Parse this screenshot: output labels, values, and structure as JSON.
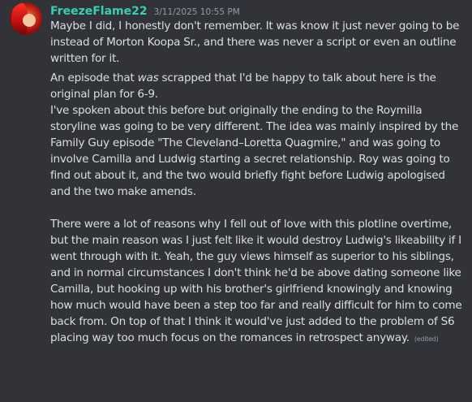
{
  "message": {
    "username": "FreezeFlame22",
    "timestamp": "3/11/2025 10:55 PM",
    "avatar_icon": "red-haired-character-avatar",
    "username_color": "#36d1b4",
    "paragraph1": "Maybe I did, I honestly don't remember. It was know it just never going to be instead of Morton Koopa Sr., and there was never a script or even an outline written for it.",
    "paragraph2_prefix": "An episode that ",
    "paragraph2_emphasis": "was",
    "paragraph2_suffix": " scrapped that I'd be happy to talk about here is the original plan for 6-9.",
    "paragraph3": "I've spoken about this before but originally the ending to the Roymilla storyline was going to be very different. The idea was mainly inspired by the Family Guy episode \"The Cleveland–Loretta Quagmire,\" and was going to involve Camilla and Ludwig starting a secret relationship. Roy was going to find out about it, and the two would briefly fight before Ludwig apologised and the two make amends.",
    "paragraph4": "There were a lot of reasons why I fell out of love with this plotline overtime, but the main reason was I just felt like it would destroy Ludwig's likeability if I went through with it. Yeah, the guy views himself as superior to his siblings, and in normal circumstances I don't think he'd be above dating someone like Camilla, but hooking up with his brother's girlfriend knowingly and knowing how much would have been a step too far and really difficult for him to come back from. On top of that I think it would've just added to the problem of S6 placing way too much focus on the romances in retrospect anyway.",
    "edited_label": "(edited)"
  }
}
